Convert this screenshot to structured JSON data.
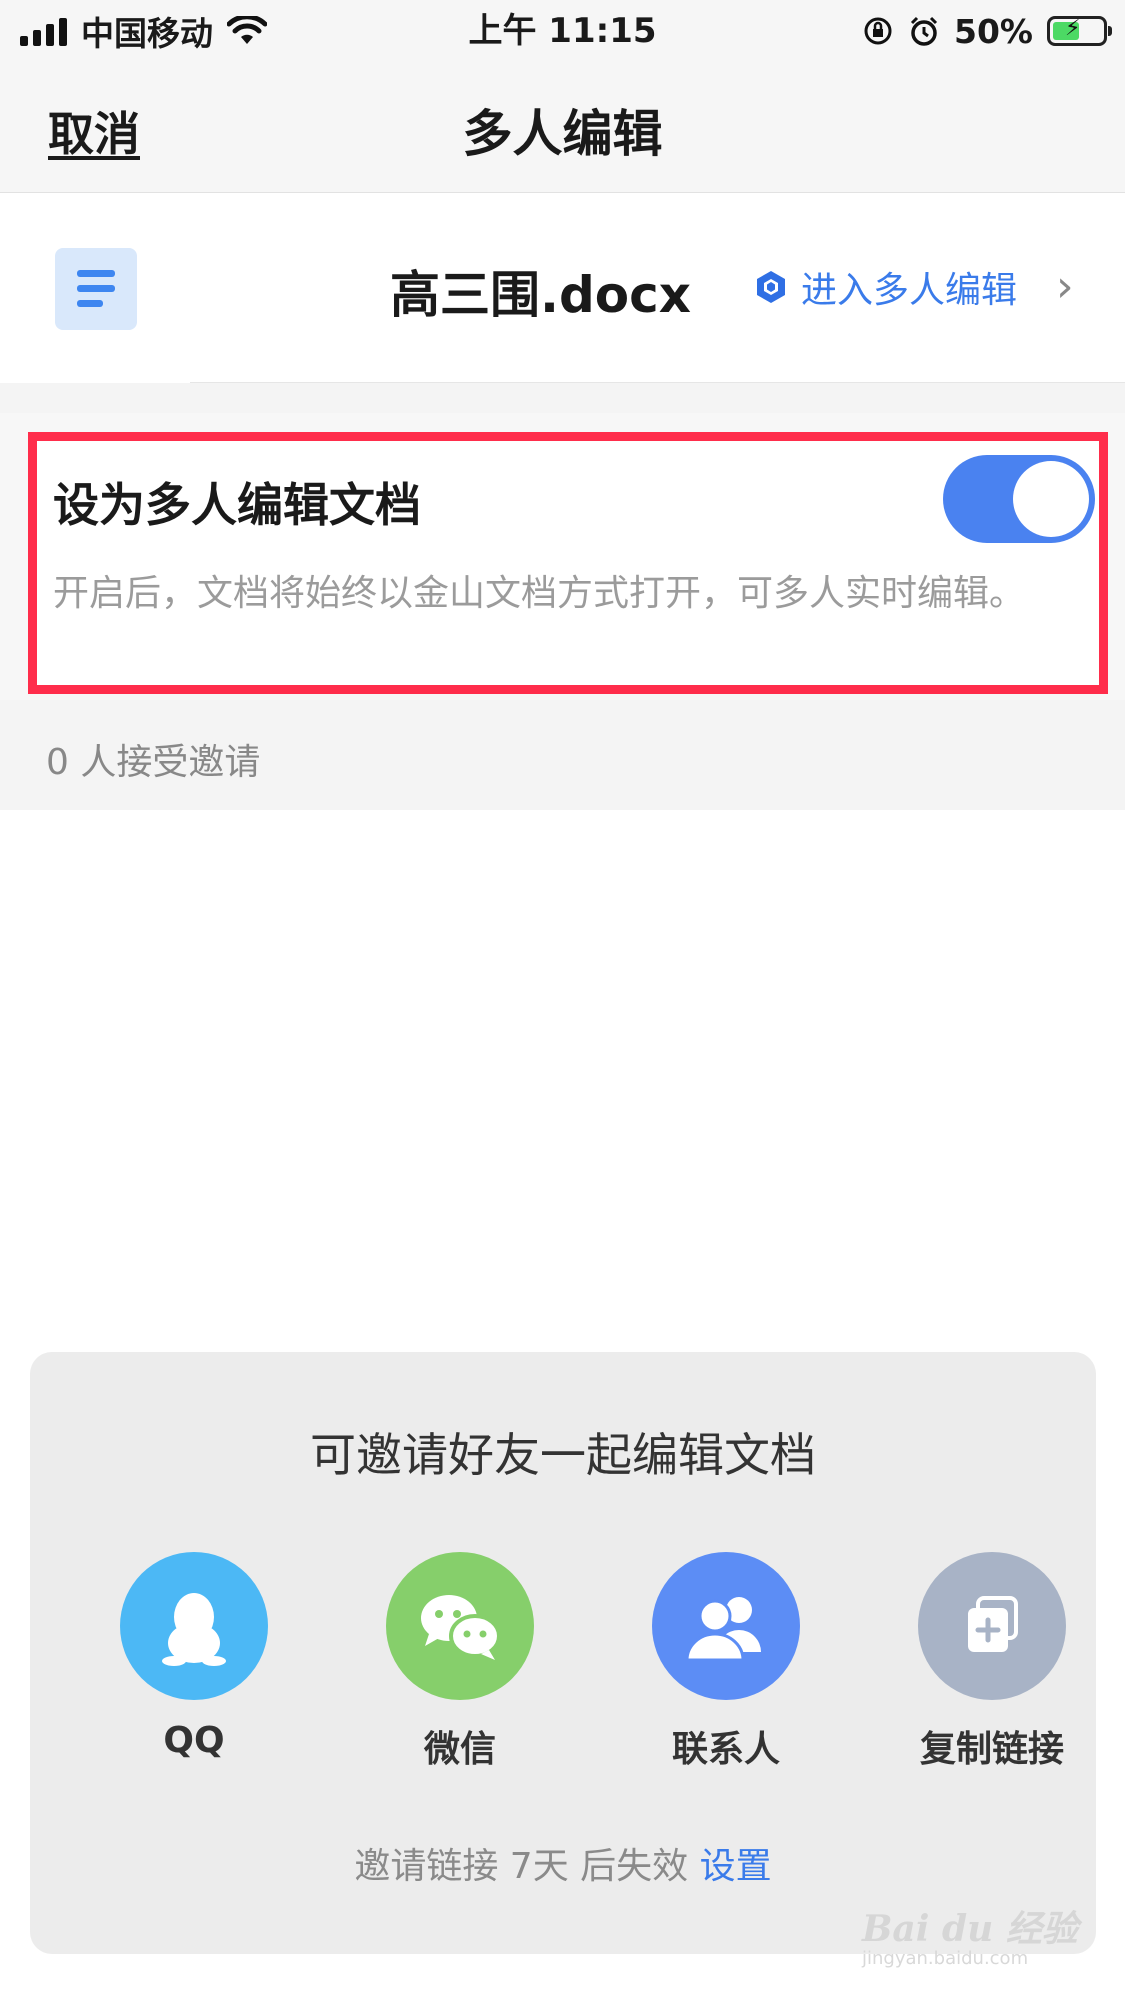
{
  "status_bar": {
    "carrier": "中国移动",
    "time": "上午 11:15",
    "battery_percent": "50%"
  },
  "nav": {
    "cancel_label": "取消",
    "title": "多人编辑"
  },
  "file": {
    "name": "高三围.docx",
    "enter_link_label": "进入多人编辑"
  },
  "setting": {
    "title": "设为多人编辑文档",
    "description": "开启后，文档将始终以金山文档方式打开，可多人实时编辑。",
    "toggle_on": true
  },
  "accepted_count_text": "0 人接受邀请",
  "invite": {
    "title": "可邀请好友一起编辑文档",
    "targets": [
      {
        "label": "QQ",
        "icon": "qq-penguin-icon",
        "color": "#4cb8f5"
      },
      {
        "label": "微信",
        "icon": "wechat-icon",
        "color": "#86cf6b"
      },
      {
        "label": "联系人",
        "icon": "contacts-icon",
        "color": "#5c8df5"
      },
      {
        "label": "复制链接",
        "icon": "copy-link-icon",
        "color": "#a8b3c6"
      }
    ],
    "expiry_text": "邀请链接 7天 后失效",
    "setting_link_label": "设置"
  },
  "watermark": {
    "brand": "Bai du 经验",
    "url": "jingyan.baidu.com"
  },
  "colors": {
    "accent": "#3a7bea",
    "highlight_border": "#ff2d4b",
    "toggle_on": "#4a82f0"
  }
}
